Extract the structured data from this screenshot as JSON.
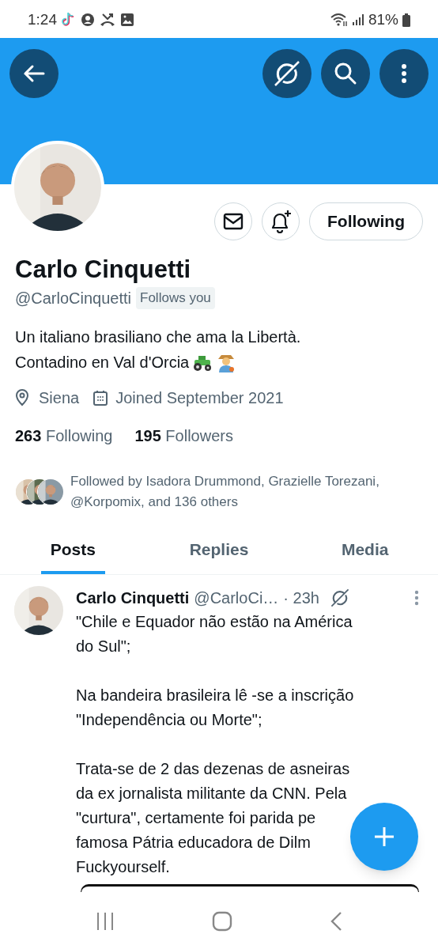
{
  "status_bar": {
    "time": "1:24",
    "battery": "81%"
  },
  "profile": {
    "name": "Carlo Cinquetti",
    "handle": "@CarloCinquetti",
    "follows_you": "Follows you",
    "bio": [
      "Un italiano brasiliano che ama la Libertà.",
      "Contadino en Val d'Orcia"
    ],
    "location": "Siena",
    "joined": "Joined September 2021",
    "follow_button": "Following",
    "stats": [
      {
        "count": "263",
        "label": "Following"
      },
      {
        "count": "195",
        "label": "Followers"
      }
    ],
    "followed_by": "Followed by Isadora Drummond, Grazielle Torezani, @Korpomix, and 136 others"
  },
  "tabs": [
    {
      "label": "Posts",
      "selected": true
    },
    {
      "label": "Replies",
      "selected": false
    },
    {
      "label": "Media",
      "selected": false
    }
  ],
  "post": {
    "name": "Carlo Cinquetti",
    "handle": "@CarloCi…",
    "time": "· 23h",
    "paragraphs": [
      [
        "\"Chile e Equador não estão na América",
        "do Sul\";"
      ],
      [
        "Na bandeira brasileira lê -se a inscrição",
        "\"Independência ou Morte\";"
      ],
      [
        "Trata-se de 2 das dezenas de asneiras",
        "da ex jornalista militante da CNN. Pela",
        "\"curtura\", certamente foi parida pe",
        "famosa Pátria educadora de Dilm",
        "Fuckyourself."
      ]
    ]
  }
}
